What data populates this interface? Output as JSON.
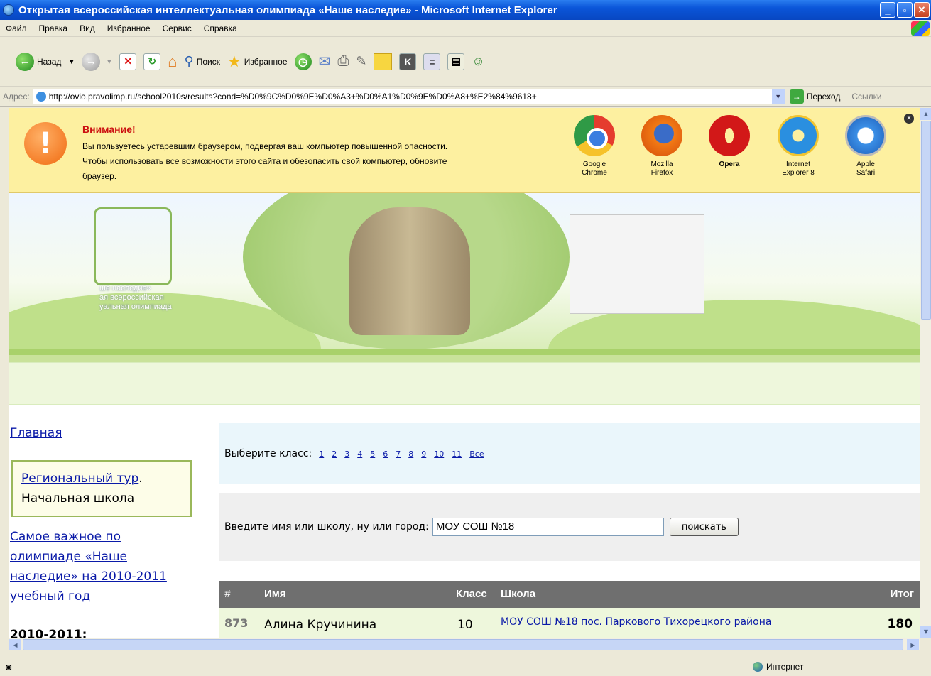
{
  "window": {
    "title": "Открытая всероссийская интеллектуальная олимпиада «Наше наследие» - Microsoft Internet Explorer",
    "buttons": [
      "_",
      "▫",
      "✕"
    ]
  },
  "menu": [
    "Файл",
    "Правка",
    "Вид",
    "Избранное",
    "Сервис",
    "Справка"
  ],
  "toolbar": {
    "back": "Назад",
    "search": "Поиск",
    "favorites": "Избранное"
  },
  "address": {
    "label": "Адрес:",
    "url": "http://ovio.pravolimp.ru/school2010s/results?cond=%D0%9C%D0%9E%D0%A3+%D0%A1%D0%9E%D0%A8+%E2%84%9618+",
    "go": "Переход",
    "links": "Ссылки"
  },
  "warning": {
    "heading": "Внимание!",
    "line1": "Вы пользуетесь устаревшим браузером, подвергая ваш компьютер повышенной опасности.",
    "line2": "Чтобы использовать все возможности этого сайта и обезопасить свой компьютер, обновите",
    "line3": "браузер.",
    "browsers": [
      {
        "line1": "Google",
        "line2": "Chrome"
      },
      {
        "line1": "Mozilla",
        "line2": "Firefox"
      },
      {
        "line1": "Opera",
        "line2": ""
      },
      {
        "line1": "Internet",
        "line2": "Explorer 8"
      },
      {
        "line1": "Apple",
        "line2": "Safari"
      }
    ]
  },
  "banner": {
    "logo_line1": "ше наследие»",
    "logo_line2": "ая всероссийская",
    "logo_line3": "уальная олимпиада"
  },
  "nav": {
    "home": "Главная",
    "regional_link": "Региональный тур",
    "regional_dot": ".",
    "regional_sub": "Начальная школа",
    "important": "Самое важное по олимпиаде «Наше наследие» на 2010-2011 учебный год",
    "year": "2010-2011:"
  },
  "class_select": {
    "label": "Выберите класс:",
    "options": [
      "1",
      "2",
      "3",
      "4",
      "5",
      "6",
      "7",
      "8",
      "9",
      "10",
      "11",
      "Все"
    ]
  },
  "search": {
    "label": "Введите имя или школу, ну или город:",
    "value": "МОУ СОШ №18",
    "button": "поискать"
  },
  "table": {
    "headers": {
      "num": "#",
      "name": "Имя",
      "class": "Класс",
      "school": "Школа",
      "total": "Итог"
    },
    "rows": [
      {
        "num": "873",
        "name": "Алина Кручинина",
        "class": "10",
        "school": "МОУ СОШ №18 пос. Паркового Тихорецкого района",
        "total": "180"
      }
    ]
  },
  "status": {
    "zone": "Интернет"
  }
}
